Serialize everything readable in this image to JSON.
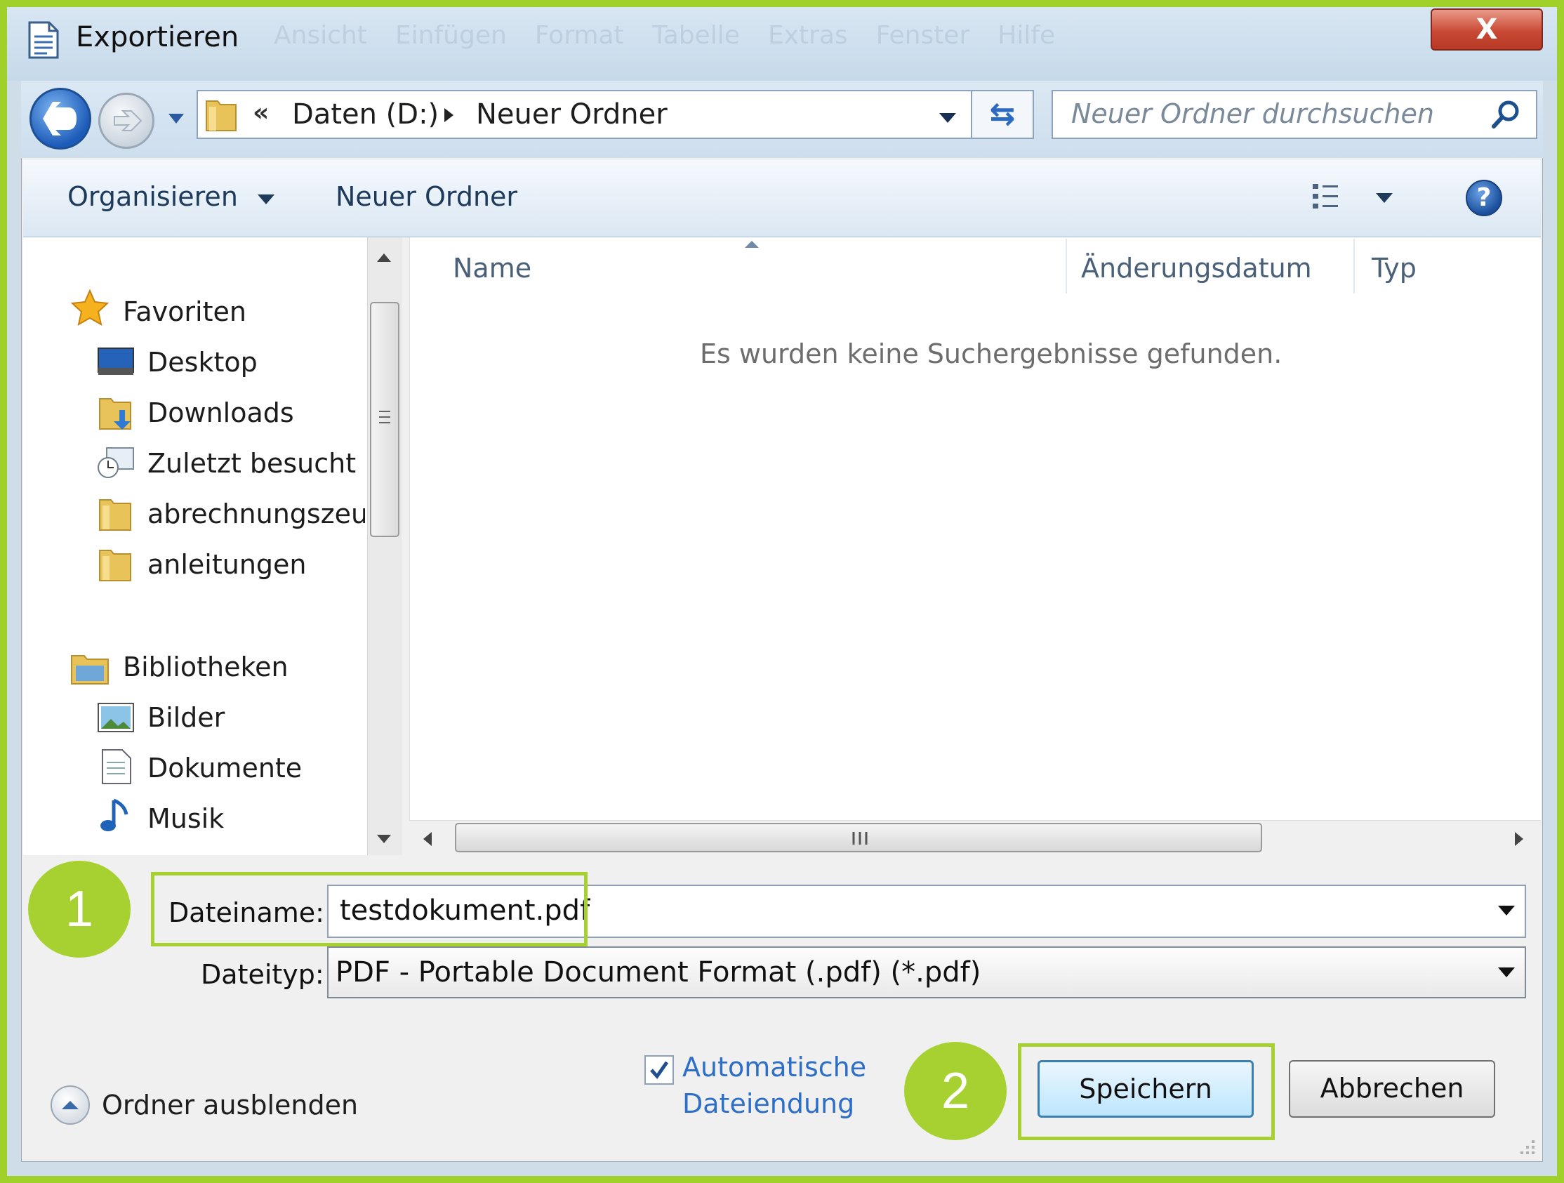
{
  "window": {
    "title": "Exportieren",
    "ghost_menu": [
      "Ansicht",
      "Einfügen",
      "Format",
      "Tabelle",
      "Extras",
      "Fenster",
      "Hilfe"
    ],
    "close_glyph": "X"
  },
  "nav": {
    "back_icon": "back-arrow-icon",
    "forward_icon": "forward-arrow-icon",
    "overflow_glyph": "«",
    "breadcrumb": [
      "Daten (D:)",
      "Neuer Ordner"
    ],
    "search_placeholder": "Neuer Ordner durchsuchen"
  },
  "toolbar": {
    "organize_label": "Organisieren",
    "new_folder_label": "Neuer Ordner"
  },
  "sidebar": {
    "favorites_header": "Favoriten",
    "favorites": [
      {
        "label": "Desktop",
        "icon": "desktop-icon"
      },
      {
        "label": "Downloads",
        "icon": "downloads-folder-icon"
      },
      {
        "label": "Zuletzt besucht",
        "icon": "recent-places-icon"
      },
      {
        "label": "abrechnungszeug",
        "icon": "folder-icon"
      },
      {
        "label": "anleitungen",
        "icon": "folder-icon"
      }
    ],
    "libraries_header": "Bibliotheken",
    "libraries": [
      {
        "label": "Bilder",
        "icon": "pictures-icon"
      },
      {
        "label": "Dokumente",
        "icon": "documents-icon"
      },
      {
        "label": "Musik",
        "icon": "music-icon"
      }
    ]
  },
  "file_list": {
    "columns": [
      "Name",
      "Änderungsdatum",
      "Typ"
    ],
    "empty_message": "Es wurden keine Suchergebnisse gefunden."
  },
  "form": {
    "filename_label": "Dateiname:",
    "filename_value": "testdokument.pdf",
    "filetype_label": "Dateityp:",
    "filetype_value": "PDF - Portable Document Format (.pdf) (*.pdf)",
    "auto_ext_line1": "Automatische",
    "auto_ext_line2": "Dateiendung",
    "auto_ext_checked": true,
    "hide_folders_label": "Ordner ausblenden",
    "save_label": "Speichern",
    "cancel_label": "Abbrechen"
  },
  "annotations": {
    "step1": "1",
    "step2": "2",
    "color": "#a6d130"
  }
}
